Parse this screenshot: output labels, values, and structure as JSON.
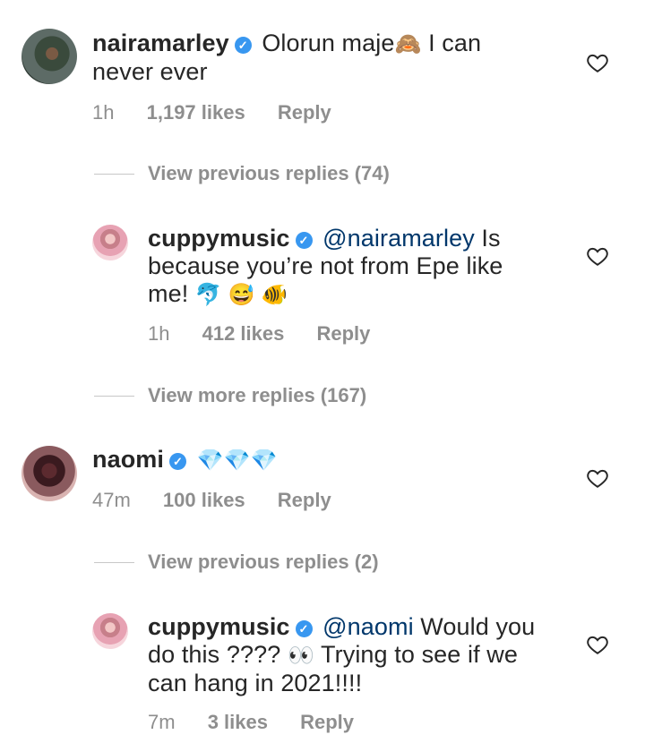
{
  "comments": [
    {
      "user": "nairamarley",
      "text_before": "Olorun maje",
      "emoji": "🙈",
      "text_after": " I can never ever",
      "time": "1h",
      "likes": "1,197 likes",
      "reply": "Reply"
    },
    {
      "user": "cuppymusic",
      "mention": "@nairamarley",
      "text_after": " Is because you’re not from Epe like me!",
      "emoji": "🐬 😅 🐠",
      "time": "1h",
      "likes": "412 likes",
      "reply": "Reply"
    },
    {
      "user": "naomi",
      "emoji": "💎💎💎",
      "time": "47m",
      "likes": "100 likes",
      "reply": "Reply"
    },
    {
      "user": "cuppymusic",
      "mention": "@naomi",
      "text_before": " Would you do this ????",
      "emoji": "👀",
      "text_after": " Trying to see if we can hang in 2021!!!!",
      "time": "7m",
      "likes": "3 likes",
      "reply": "Reply"
    }
  ],
  "view_links": [
    {
      "label": "View previous replies (74)"
    },
    {
      "label": "View more replies (167)"
    },
    {
      "label": "View previous replies (2)"
    }
  ],
  "verified_badge": "✓",
  "heart_icon": "heart-outline-icon"
}
